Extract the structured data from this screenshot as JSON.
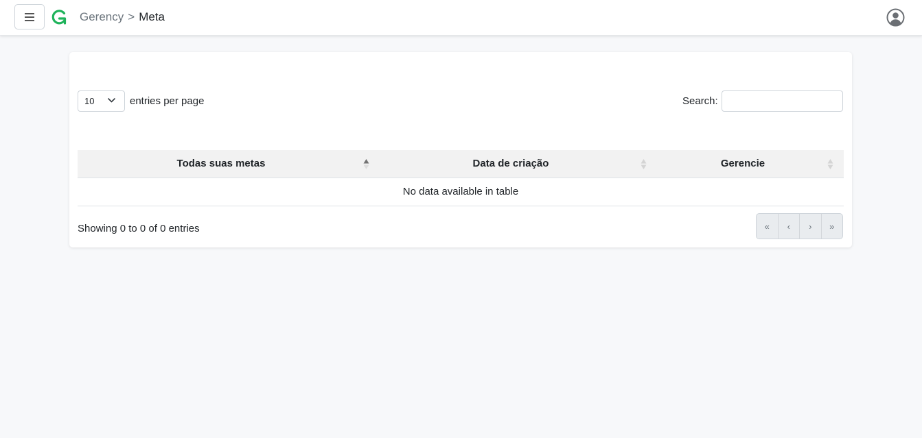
{
  "header": {
    "breadcrumb_root": "Gerency",
    "breadcrumb_separator": ">",
    "breadcrumb_current": "Meta",
    "brand_color": "#1fb35b"
  },
  "table_controls": {
    "page_length_value": "10",
    "page_length_label": "entries per page",
    "search_label": "Search:",
    "search_value": ""
  },
  "table": {
    "columns": [
      "Todas suas metas",
      "Data de criação",
      "Gerencie"
    ],
    "sorted_column": "Todas suas metas",
    "sort_direction": "asc",
    "empty_message": "No data available in table"
  },
  "footer": {
    "info": "Showing 0 to 0 of 0 entries",
    "pagination": [
      "«",
      "‹",
      "›",
      "»"
    ]
  }
}
